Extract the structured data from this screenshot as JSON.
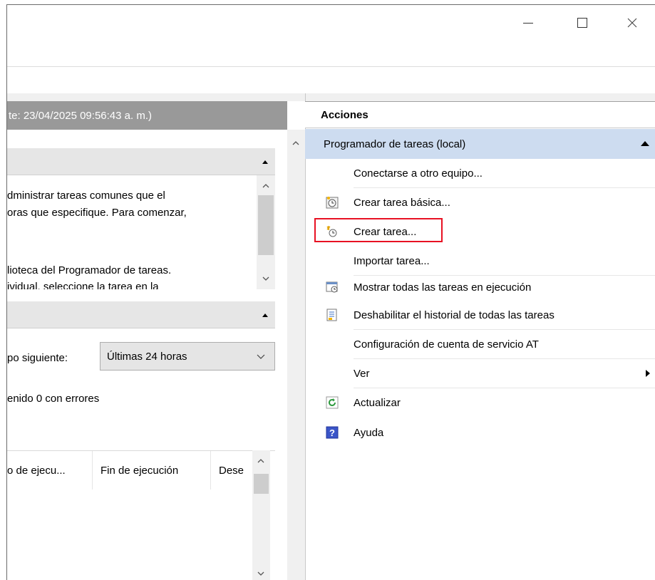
{
  "window": {
    "minimize_glyph": "—",
    "maximize_glyph": "☐",
    "close_glyph": "✕"
  },
  "left": {
    "header_text": "te: 23/04/2025 09:56:43 a. m.)",
    "overview": {
      "line1": "dministrar tareas comunes que el",
      "line2": "oras que especifique. Para comenzar,",
      "line3": "lioteca del Programador de tareas.",
      "line4": "ividual, seleccione la tarea en la"
    },
    "status": {
      "filter_label": "po siguiente:",
      "filter_value": "Últimas 24 horas",
      "summary": "enido  0 con errores"
    },
    "table": {
      "columns": [
        "o de ejecu...",
        "Fin de ejecución",
        "Dese"
      ]
    }
  },
  "actions": {
    "title": "Acciones",
    "group": "Programador de tareas (local)",
    "items": [
      {
        "label": "Conectarse a otro equipo...",
        "icon": "none"
      },
      {
        "label": "Crear tarea básica...",
        "icon": "basic-task-icon"
      },
      {
        "label": "Crear tarea...",
        "icon": "create-task-icon"
      },
      {
        "label": "Importar tarea...",
        "icon": "none"
      },
      {
        "label": "Mostrar todas las tareas en ejecución",
        "icon": "running-tasks-icon"
      },
      {
        "label": "Deshabilitar el historial de todas las tareas",
        "icon": "history-icon"
      },
      {
        "label": "Configuración de cuenta de servicio AT",
        "icon": "none"
      },
      {
        "label": "Ver",
        "icon": "none"
      },
      {
        "label": "Actualizar",
        "icon": "refresh-icon"
      },
      {
        "label": "Ayuda",
        "icon": "help-icon"
      }
    ]
  },
  "colors": {
    "highlight_box": "#e81123",
    "group_bg": "#cddcf0",
    "left_header_bg": "#999999"
  }
}
